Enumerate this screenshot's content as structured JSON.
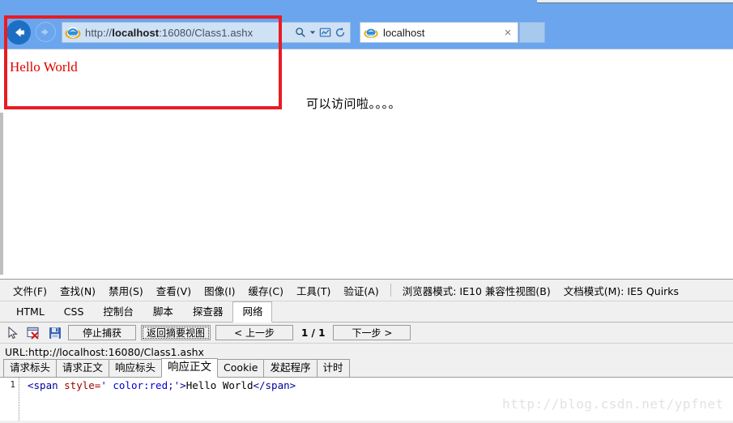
{
  "browser": {
    "back_label": "Back",
    "forward_label": "Forward",
    "address": {
      "scheme": "http://",
      "host": "localhost",
      "rest": ":16080/Class1.ashx",
      "full": "http://localhost:16080/Class1.ashx"
    },
    "addr_icons": [
      "search-icon",
      "dropdown-arrow-icon",
      "compatibility-view-icon",
      "refresh-icon"
    ],
    "tab": {
      "title": "localhost",
      "close_label": "×"
    },
    "newtab_label": ""
  },
  "page": {
    "hello_world": "Hello World",
    "chinese_note": "可以访问啦。。。。"
  },
  "devtools": {
    "menu": [
      {
        "label": "文件(F)"
      },
      {
        "label": "查找(N)"
      },
      {
        "label": "禁用(S)"
      },
      {
        "label": "查看(V)"
      },
      {
        "label": "图像(I)"
      },
      {
        "label": "缓存(C)"
      },
      {
        "label": "工具(T)"
      },
      {
        "label": "验证(A)"
      }
    ],
    "browser_mode": "浏览器模式: IE10 兼容性视图(B)",
    "document_mode": "文档模式(M): IE5 Quirks",
    "tabs": [
      {
        "label": "HTML",
        "active": false
      },
      {
        "label": "CSS",
        "active": false
      },
      {
        "label": "控制台",
        "active": false
      },
      {
        "label": "脚本",
        "active": false
      },
      {
        "label": "探查器",
        "active": false
      },
      {
        "label": "网络",
        "active": true
      }
    ],
    "toolbar": {
      "icons": [
        "pointer-select-icon",
        "clear-capture-icon",
        "save-icon"
      ],
      "stop_capture": "停止捕获",
      "back_to_summary": "返回摘要视图",
      "prev_step": "< 上一步",
      "pager": "1 / 1",
      "next_step": "下一步 >"
    },
    "url_line": "URL:http://localhost:16080/Class1.ashx",
    "subtabs": [
      {
        "label": "请求标头",
        "active": false
      },
      {
        "label": "请求正文",
        "active": false
      },
      {
        "label": "响应标头",
        "active": false
      },
      {
        "label": "响应正文",
        "active": true
      },
      {
        "label": "Cookie",
        "active": false
      },
      {
        "label": "发起程序",
        "active": false
      },
      {
        "label": "计时",
        "active": false
      }
    ],
    "code": {
      "line_number": "1",
      "tag_open": "<span ",
      "attr_name": "style=",
      "attr_value": "' color:red;'",
      "tag_close_bracket": ">",
      "text": "Hello World",
      "tag_end": "</span>",
      "full": "<span style=' color:red;'>Hello World</span>"
    }
  },
  "watermark": "http://blog.csdn.net/ypfnet",
  "colors": {
    "chrome_blue": "#6aa5ee",
    "highlight_red": "#e81c24",
    "hello_red": "#e00000",
    "devtools_bg": "#f0f0f0"
  }
}
